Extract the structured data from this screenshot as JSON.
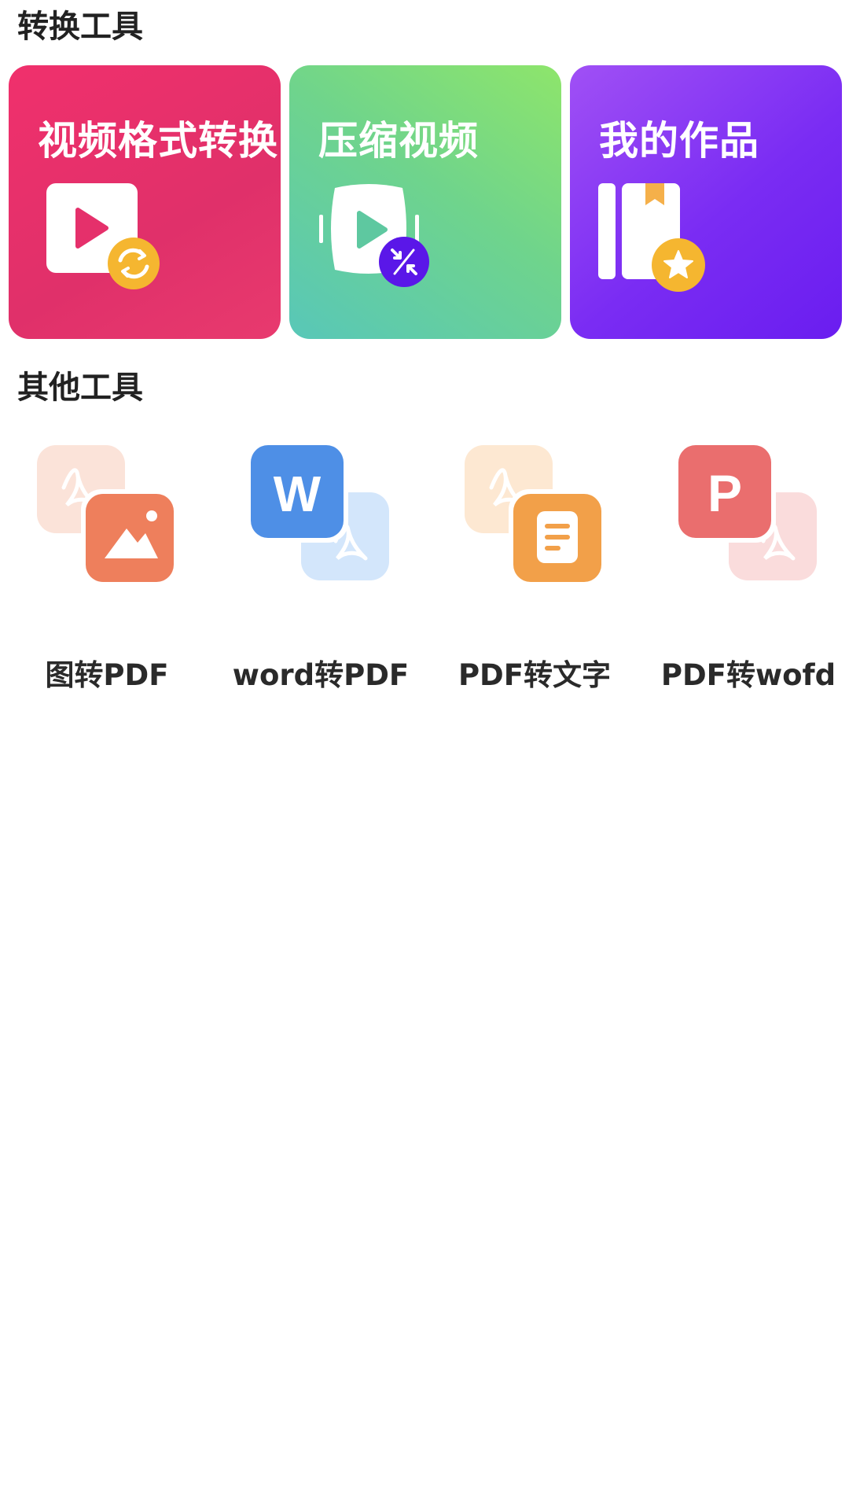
{
  "sections": {
    "convert_title": "转换工具",
    "other_title": "其他工具"
  },
  "cards": [
    {
      "label": "视频格式转换",
      "icon": "video-convert-icon",
      "color": "#e5306b"
    },
    {
      "label": "压缩视频",
      "icon": "video-compress-icon",
      "color": "#6fd48c"
    },
    {
      "label": "我的作品",
      "icon": "my-works-icon",
      "color": "#7a2cf3"
    }
  ],
  "tools": [
    {
      "label": "图转PDF",
      "icon": "image-to-pdf-icon"
    },
    {
      "label": "word转PDF",
      "icon": "word-to-pdf-icon"
    },
    {
      "label": "PDF转文字",
      "icon": "pdf-to-text-icon"
    },
    {
      "label": "PDF转wofd",
      "icon": "pdf-to-ofd-icon"
    }
  ]
}
